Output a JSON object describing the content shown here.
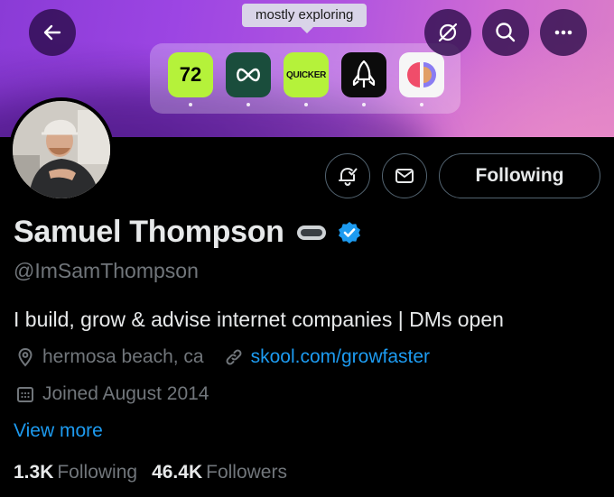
{
  "banner": {
    "tooltip": "mostly exploring",
    "dock_apps": [
      {
        "name": "72-app",
        "label": "72"
      },
      {
        "name": "infinity-app",
        "label": ""
      },
      {
        "name": "quicker-app",
        "label": "QUICKER"
      },
      {
        "name": "rocket-app",
        "label": ""
      },
      {
        "name": "pie-app",
        "label": ""
      }
    ]
  },
  "header_buttons": {
    "back": "back-arrow-icon",
    "nosync": "no-sync-icon",
    "search": "search-icon",
    "more": "more-icon"
  },
  "profile": {
    "display_name": "Samuel Thompson",
    "handle": "@ImSamThompson",
    "bio": "I build, grow & advise internet companies | DMs open",
    "location": "hermosa beach, ca",
    "website": "skool.com/growfaster",
    "joined": "Joined August 2014",
    "view_more": "View more",
    "following_count": "1.3K",
    "following_label": "Following",
    "followers_count": "46.4K",
    "followers_label": "Followers"
  },
  "actions": {
    "following_button": "Following"
  },
  "colors": {
    "link": "#1d9bf0",
    "muted": "#71767b",
    "text": "#e7e9ea",
    "verified": "#1d9bf0",
    "lime": "#b5f23a"
  }
}
